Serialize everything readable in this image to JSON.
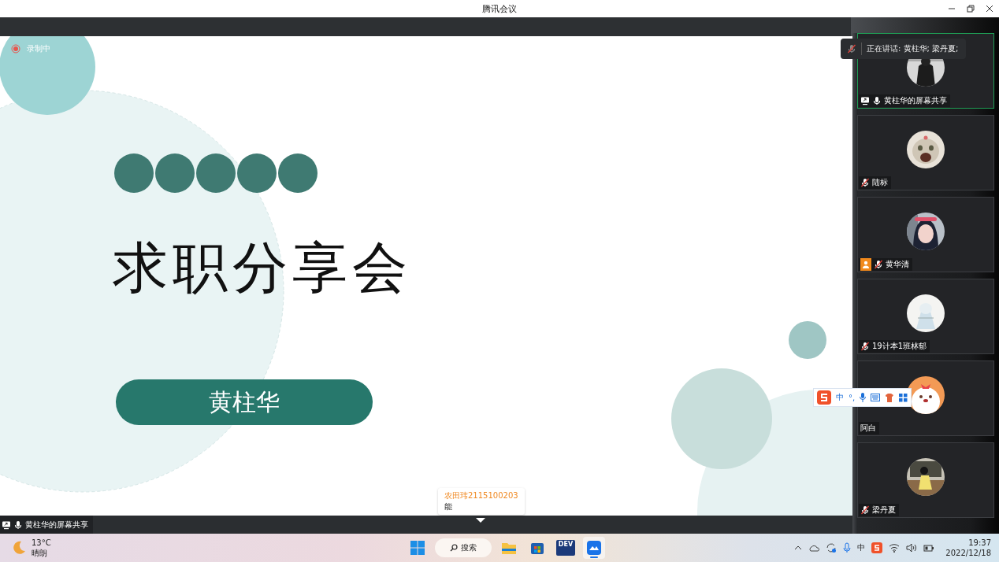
{
  "window": {
    "title": "腾讯会议"
  },
  "recording": {
    "label": "录制中",
    "on": true
  },
  "slide": {
    "title": "求职分享会",
    "presenter": "黄柱华"
  },
  "share_bar": {
    "label": "黄柱华的屏幕共享",
    "muted": false
  },
  "speaking_toast": {
    "text": "正在讲话: 黄柱华; 梁丹夏;"
  },
  "participants": [
    {
      "name": "黄柱华的屏幕共享",
      "mic_icon": true,
      "muted": false,
      "screen_share": true,
      "host_badge": false,
      "selected": true
    },
    {
      "name": "陆标",
      "mic_icon": true,
      "muted": true,
      "screen_share": false,
      "host_badge": false,
      "selected": false
    },
    {
      "name": "黄华清",
      "mic_icon": true,
      "muted": true,
      "screen_share": false,
      "host_badge": true,
      "selected": false
    },
    {
      "name": "19计本1班林郁",
      "mic_icon": true,
      "muted": true,
      "screen_share": false,
      "host_badge": false,
      "selected": false
    },
    {
      "name": "阿白",
      "mic_icon": false,
      "screen_share": false,
      "host_badge": false,
      "selected": false
    },
    {
      "name": "梁丹夏",
      "mic_icon": true,
      "muted": true,
      "screen_share": false,
      "host_badge": false,
      "selected": false
    }
  ],
  "ime_toolbar": {
    "mode": "中",
    "punct": "°,"
  },
  "tooltip": {
    "name": "农田玮2115100203",
    "text": "能"
  },
  "taskbar": {
    "weather": {
      "temp": "13°C",
      "desc": "晴朗"
    },
    "search": {
      "label": "搜索"
    },
    "apps": [
      {
        "kind": "explorer",
        "selected": false
      },
      {
        "kind": "store",
        "selected": false
      },
      {
        "kind": "dev",
        "label": "DEV",
        "selected": false
      },
      {
        "kind": "meeting",
        "selected": true
      }
    ],
    "tray": {
      "ime": "中"
    },
    "clock": {
      "time": "19:37",
      "date": "2022/12/18"
    }
  }
}
